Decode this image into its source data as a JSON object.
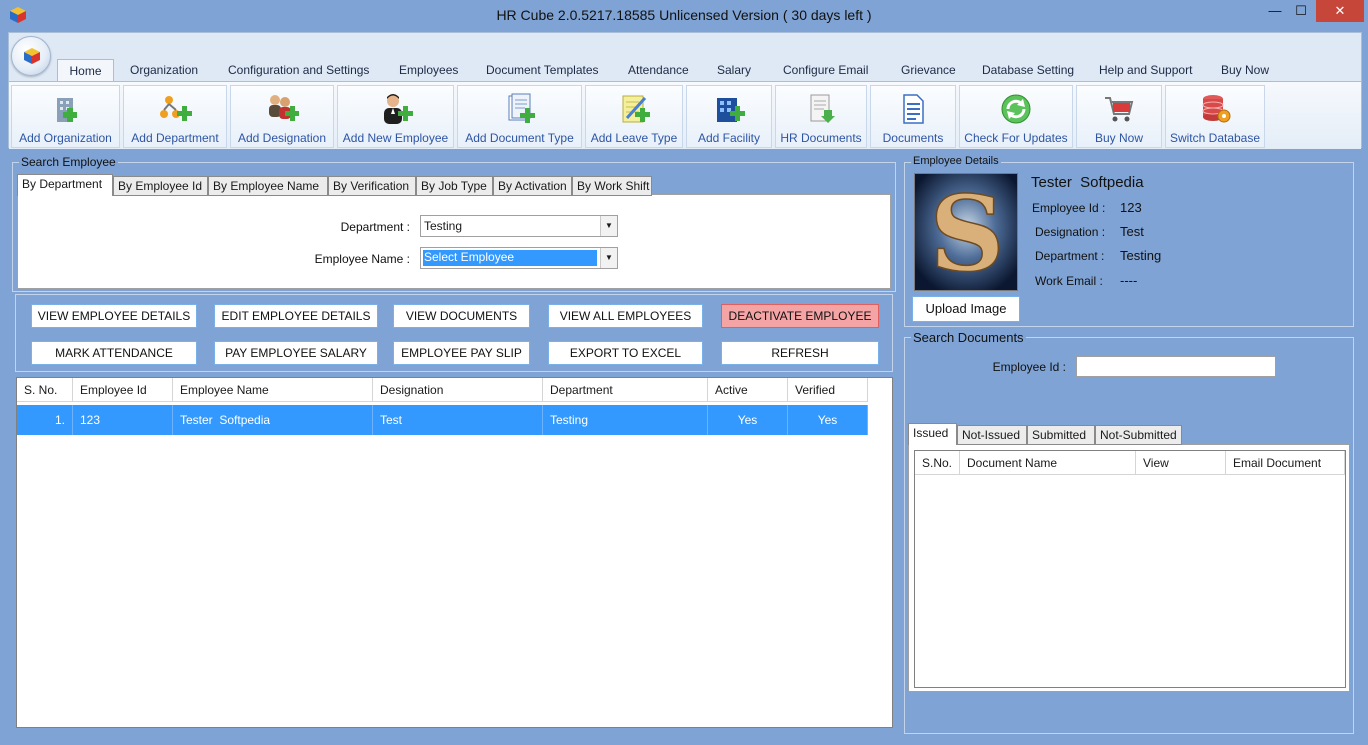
{
  "window": {
    "title": "HR Cube 2.0.5217.18585 Unlicensed Version ( 30 days left )",
    "min_glyph": "—",
    "max_glyph": "☐",
    "close_glyph": "✕"
  },
  "ribbon": {
    "tabs": [
      "Home",
      "Organization",
      "Configuration and Settings",
      "Employees",
      "Document Templates",
      "Attendance",
      "Salary",
      "Configure Email",
      "Grievance",
      "Database Setting",
      "Help and Support",
      "Buy Now"
    ],
    "active_tab": "Home",
    "buttons": [
      {
        "label": "Add Organization",
        "icon": "organization-icon"
      },
      {
        "label": "Add Department",
        "icon": "department-icon"
      },
      {
        "label": "Add Designation",
        "icon": "designation-icon"
      },
      {
        "label": "Add New Employee",
        "icon": "employee-icon"
      },
      {
        "label": "Add Document Type",
        "icon": "document-type-icon"
      },
      {
        "label": "Add Leave Type",
        "icon": "leave-type-icon"
      },
      {
        "label": "Add Facility",
        "icon": "facility-icon"
      },
      {
        "label": "HR Documents",
        "icon": "hr-documents-icon"
      },
      {
        "label": "Documents",
        "icon": "documents-icon"
      },
      {
        "label": "Check For Updates",
        "icon": "refresh-icon"
      },
      {
        "label": "Buy Now",
        "icon": "cart-icon"
      },
      {
        "label": "Switch Database",
        "icon": "database-icon"
      }
    ]
  },
  "search": {
    "title": "Search Employee",
    "tabs": [
      "By Department",
      "By Employee Id",
      "By Employee Name",
      "By Verification",
      "By Job Type",
      "By Activation",
      "By Work Shift"
    ],
    "active_tab": "By Department",
    "department_label": "Department :",
    "department_value": "Testing",
    "employee_label": "Employee Name :",
    "employee_value": "Select Employee"
  },
  "actions": {
    "view_details": "VIEW EMPLOYEE DETAILS",
    "edit_details": "EDIT EMPLOYEE DETAILS",
    "view_documents": "VIEW DOCUMENTS",
    "view_all": "VIEW ALL EMPLOYEES",
    "deactivate": "DEACTIVATE EMPLOYEE",
    "attendance": "MARK ATTENDANCE",
    "pay_salary": "PAY EMPLOYEE SALARY",
    "pay_slip": "EMPLOYEE PAY SLIP",
    "export": "EXPORT TO EXCEL",
    "refresh": "REFRESH"
  },
  "employees": {
    "columns": [
      "S. No.",
      "Employee Id",
      "Employee Name",
      "Designation",
      "Department",
      "Active",
      "Verified"
    ],
    "rows": [
      [
        "1.",
        "123",
        "Tester  Softpedia",
        "Test",
        "Testing",
        "Yes",
        "Yes"
      ]
    ]
  },
  "details": {
    "title": "Employee Details",
    "name": "Tester  Softpedia",
    "id_label": "Employee Id :",
    "id_value": "123",
    "designation_label": "Designation :",
    "designation_value": "Test",
    "department_label": "Department :",
    "department_value": "Testing",
    "email_label": "Work Email :",
    "email_value": "----",
    "upload_label": "Upload Image",
    "photo_letter": "S"
  },
  "search_docs": {
    "title": "Search Documents",
    "id_label": "Employee Id :",
    "id_value": "",
    "tabs": [
      "Issued",
      "Not-Issued",
      "Submitted",
      "Not-Submitted"
    ],
    "active_tab": "Issued",
    "columns": [
      "S.No.",
      "Document Name",
      "View",
      "Email Document"
    ]
  },
  "colors": {
    "window_bg": "#7fa3d4",
    "selection": "#3399ff",
    "danger": "#f4a4a4",
    "ribbon_text": "#2d55a5"
  }
}
